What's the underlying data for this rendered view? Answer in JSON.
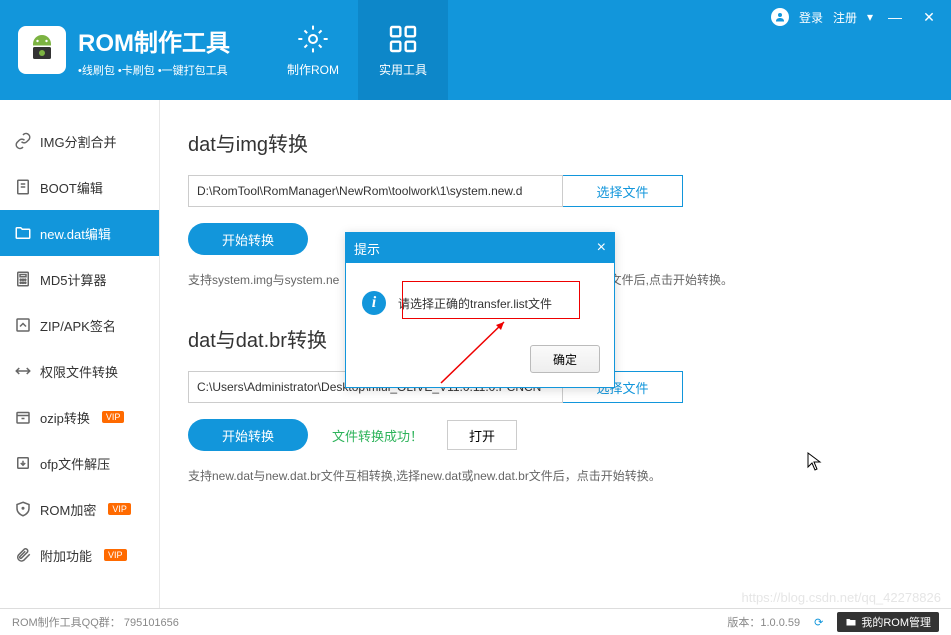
{
  "header": {
    "title": "ROM制作工具",
    "subtitle": "•线刷包 •卡刷包 •一键打包工具",
    "tab1": "制作ROM",
    "tab2": "实用工具",
    "login": "登录",
    "register": "注册"
  },
  "sidebar": {
    "items": [
      {
        "label": "IMG分割合并"
      },
      {
        "label": "BOOT编辑"
      },
      {
        "label": "new.dat编辑"
      },
      {
        "label": "MD5计算器"
      },
      {
        "label": "ZIP/APK签名"
      },
      {
        "label": "权限文件转换"
      },
      {
        "label": "ozip转换",
        "vip": true
      },
      {
        "label": "ofp文件解压"
      },
      {
        "label": "ROM加密",
        "vip": true
      },
      {
        "label": "附加功能",
        "vip": true
      }
    ],
    "vip_label": "VIP"
  },
  "section1": {
    "title": "dat与img转换",
    "path": "D:\\RomTool\\RomManager\\NewRom\\toolwork\\1\\system.new.d",
    "select": "选择文件",
    "start": "开始转换",
    "hint": "支持system.img与system.new.dat转换,选择img文件后,点击开始转换。",
    "hint_left": "支持system.img与system.ne",
    "hint_right": "mg文件后,点击开始转换。"
  },
  "section2": {
    "title": "dat与dat.br转换",
    "path": "C:\\Users\\Administrator\\Desktop\\miui_OLIVE_V11.0.11.0.PCNCN",
    "select": "选择文件",
    "start": "开始转换",
    "success": "文件转换成功！",
    "open": "打开",
    "hint": "支持new.dat与new.dat.br文件互相转换,选择new.dat或new.dat.br文件后，点击开始转换。"
  },
  "dialog": {
    "title": "提示",
    "message": "请选择正确的transfer.list文件",
    "ok": "确定"
  },
  "status": {
    "qq_label": "ROM制作工具QQ群：",
    "qq_num": "795101656",
    "version_label": "版本：",
    "version": "1.0.0.59",
    "my_rom": "我的ROM管理"
  },
  "watermark": "https://blog.csdn.net/qq_42278826"
}
